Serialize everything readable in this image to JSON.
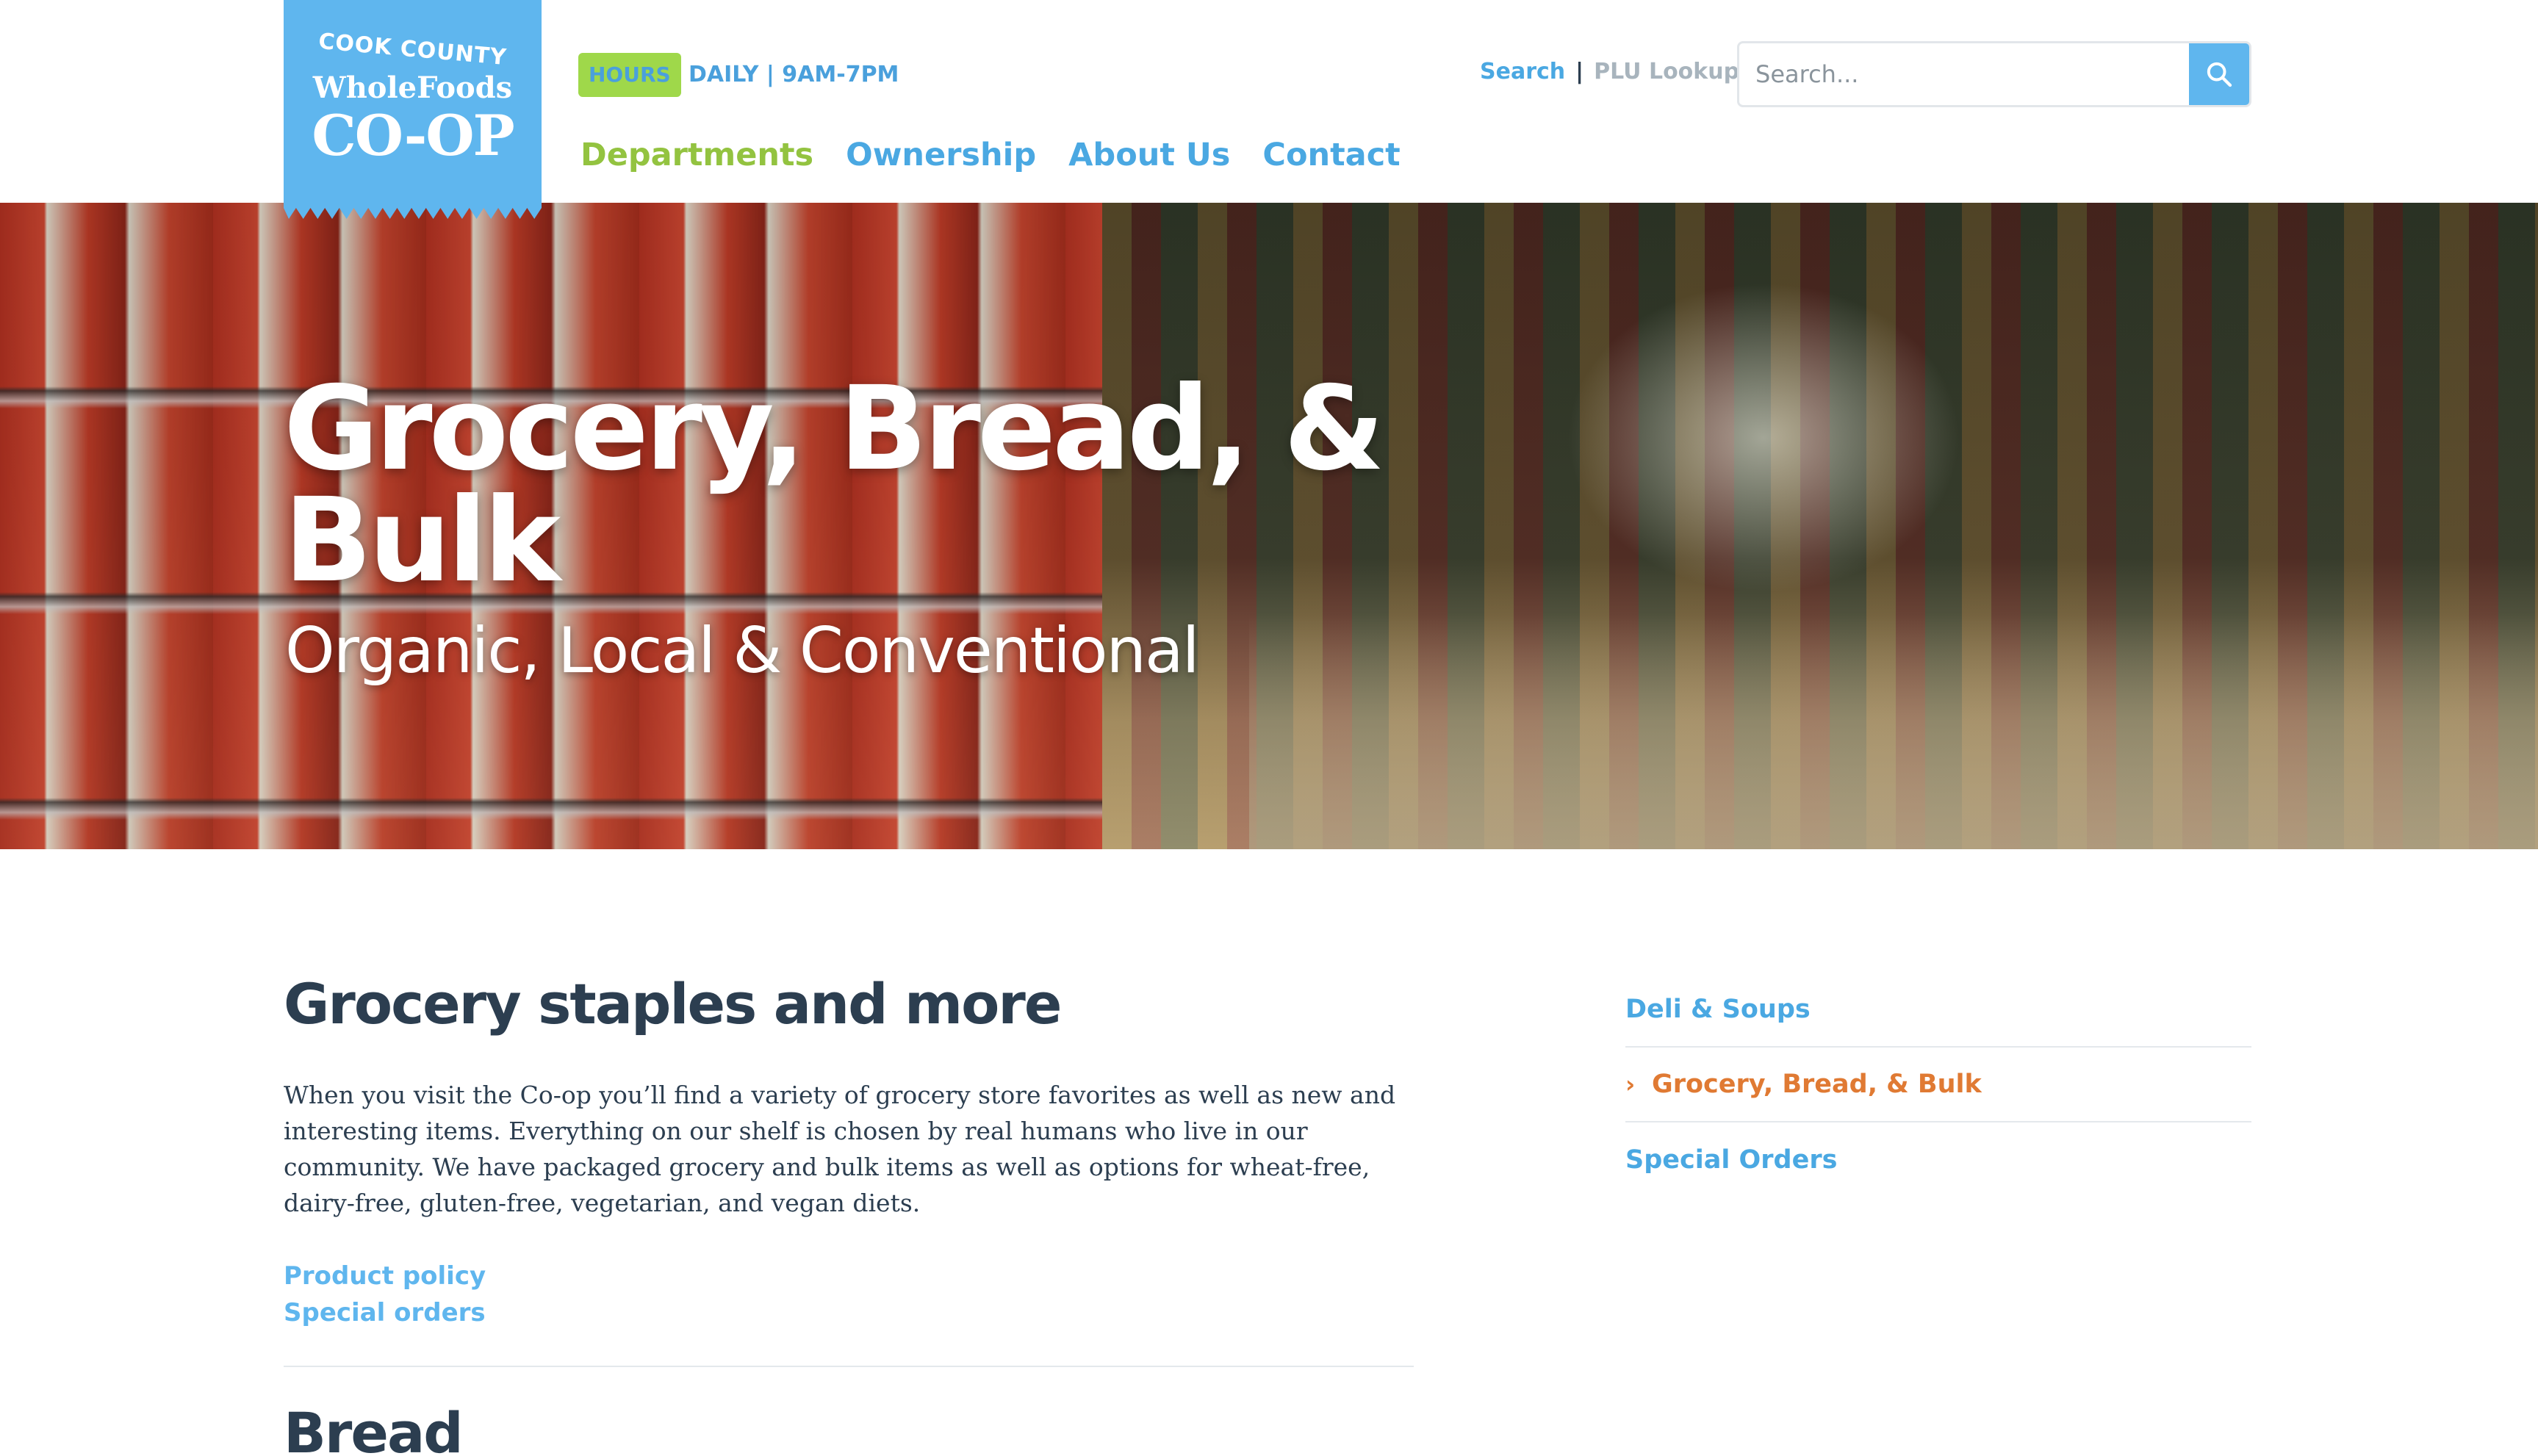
{
  "logo": {
    "line1": "COOK COUNTY",
    "line2": "WholeFoods",
    "line3": "CO-OP"
  },
  "hours": {
    "badge": "HOURS",
    "text": "DAILY | 9AM-7PM"
  },
  "nav": {
    "items": [
      "Departments",
      "Ownership",
      "About Us",
      "Contact"
    ],
    "active": "Departments"
  },
  "utility": {
    "search_link": "Search",
    "separator": "|",
    "plu_link": "PLU Lookup"
  },
  "search": {
    "placeholder": "Search...",
    "value": ""
  },
  "hero": {
    "title": "Grocery, Bread, & Bulk",
    "subtitle": "Organic, Local & Conventional"
  },
  "main": {
    "heading": "Grocery staples and more",
    "intro": "When you visit the Co-op you’ll find a variety of grocery store favorites as well as new and interesting items. Everything on our shelf is chosen by real humans who live in our community. We have packaged grocery and bulk items as well as options for wheat-free, dairy-free, gluten-free, vegetarian, and vegan diets.",
    "links": [
      "Product policy",
      "Special orders"
    ],
    "next_heading": "Bread"
  },
  "sidebar": {
    "items": [
      "Deli & Soups",
      "Grocery, Bread, & Bulk",
      "Special Orders"
    ],
    "active": "Grocery, Bread, & Bulk"
  },
  "colors": {
    "brand_blue": "#5fb6ee",
    "link_blue": "#4aa8e2",
    "green": "#93c340",
    "orange": "#e07a33",
    "dark_text": "#2c3e50"
  },
  "icons": {
    "search_button": "search-icon",
    "active_marker": "chevron-right-icon"
  }
}
